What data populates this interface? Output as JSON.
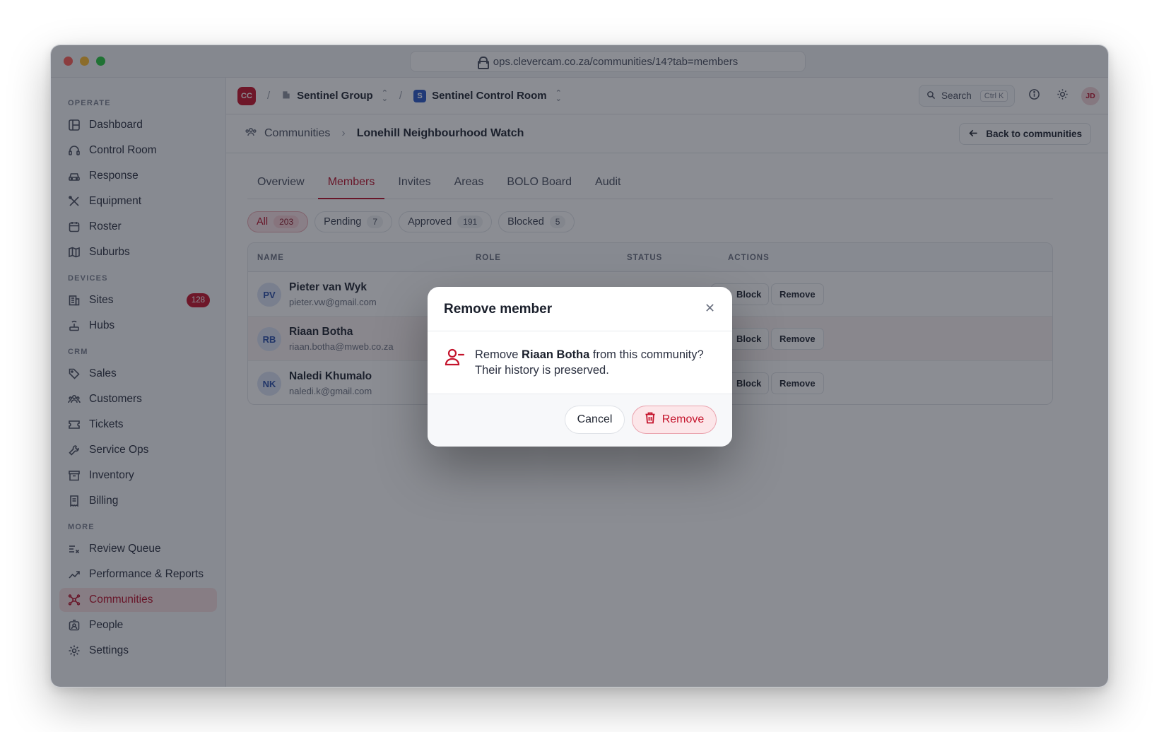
{
  "browser": {
    "url": "ops.clevercam.co.za/communities/14?tab=members"
  },
  "sidebar": {
    "sections": [
      {
        "label": "OPERATE",
        "items": [
          {
            "label": "Dashboard",
            "icon": "layout-icon"
          },
          {
            "label": "Control Room",
            "icon": "headset-icon"
          },
          {
            "label": "Response",
            "icon": "car-icon"
          },
          {
            "label": "Equipment",
            "icon": "tools-icon"
          },
          {
            "label": "Roster",
            "icon": "calendar-icon"
          },
          {
            "label": "Suburbs",
            "icon": "map-icon"
          }
        ]
      },
      {
        "label": "DEVICES",
        "items": [
          {
            "label": "Sites",
            "icon": "building-icon",
            "badge": "128"
          },
          {
            "label": "Hubs",
            "icon": "router-icon"
          }
        ]
      },
      {
        "label": "CRM",
        "items": [
          {
            "label": "Sales",
            "icon": "tag-icon"
          },
          {
            "label": "Customers",
            "icon": "users-icon"
          },
          {
            "label": "Tickets",
            "icon": "ticket-icon"
          },
          {
            "label": "Service Ops",
            "icon": "wrench-icon"
          },
          {
            "label": "Inventory",
            "icon": "archive-icon"
          },
          {
            "label": "Billing",
            "icon": "receipt-icon"
          }
        ]
      },
      {
        "label": "MORE",
        "items": [
          {
            "label": "Review Queue",
            "icon": "list-check-icon"
          },
          {
            "label": "Performance & Reports",
            "icon": "trend-icon"
          },
          {
            "label": "Communities",
            "icon": "network-icon",
            "active": true
          },
          {
            "label": "People",
            "icon": "id-badge-icon"
          },
          {
            "label": "Settings",
            "icon": "gear-icon"
          }
        ]
      }
    ]
  },
  "topbar": {
    "org_initials": "CC",
    "org_name": "Sentinel Group",
    "workspace_initial": "S",
    "workspace_name": "Sentinel Control Room",
    "search_label": "Search",
    "search_shortcut": "Ctrl K",
    "user_initials": "JD"
  },
  "breadcrumb": {
    "parent": "Communities",
    "current": "Lonehill Neighbourhood Watch",
    "back_label": "Back to communities"
  },
  "tabs": [
    "Overview",
    "Members",
    "Invites",
    "Areas",
    "BOLO Board",
    "Audit"
  ],
  "active_tab": "Members",
  "filters": [
    {
      "label": "All",
      "count": "203",
      "active": true
    },
    {
      "label": "Pending",
      "count": "7"
    },
    {
      "label": "Approved",
      "count": "191"
    },
    {
      "label": "Blocked",
      "count": "5"
    }
  ],
  "table": {
    "columns": [
      "NAME",
      "ROLE",
      "STATUS",
      "ACTIONS"
    ],
    "rows": [
      {
        "initials": "PV",
        "name": "Pieter van Wyk",
        "email": "pieter.vw@gmail.com"
      },
      {
        "initials": "RB",
        "name": "Riaan Botha",
        "email": "riaan.botha@mweb.co.za",
        "highlight": true
      },
      {
        "initials": "NK",
        "name": "Naledi Khumalo",
        "email": "naledi.k@gmail.com"
      }
    ],
    "block_label": "Block",
    "remove_label": "Remove"
  },
  "modal": {
    "title": "Remove member",
    "text_prefix": "Remove ",
    "member_name": "Riaan Botha",
    "text_suffix": " from this community? Their history is preserved.",
    "cancel_label": "Cancel",
    "confirm_label": "Remove"
  },
  "colors": {
    "accent": "#c4132b",
    "active_bg": "#f7dfe1",
    "workspace_blue": "#2a59c7"
  }
}
